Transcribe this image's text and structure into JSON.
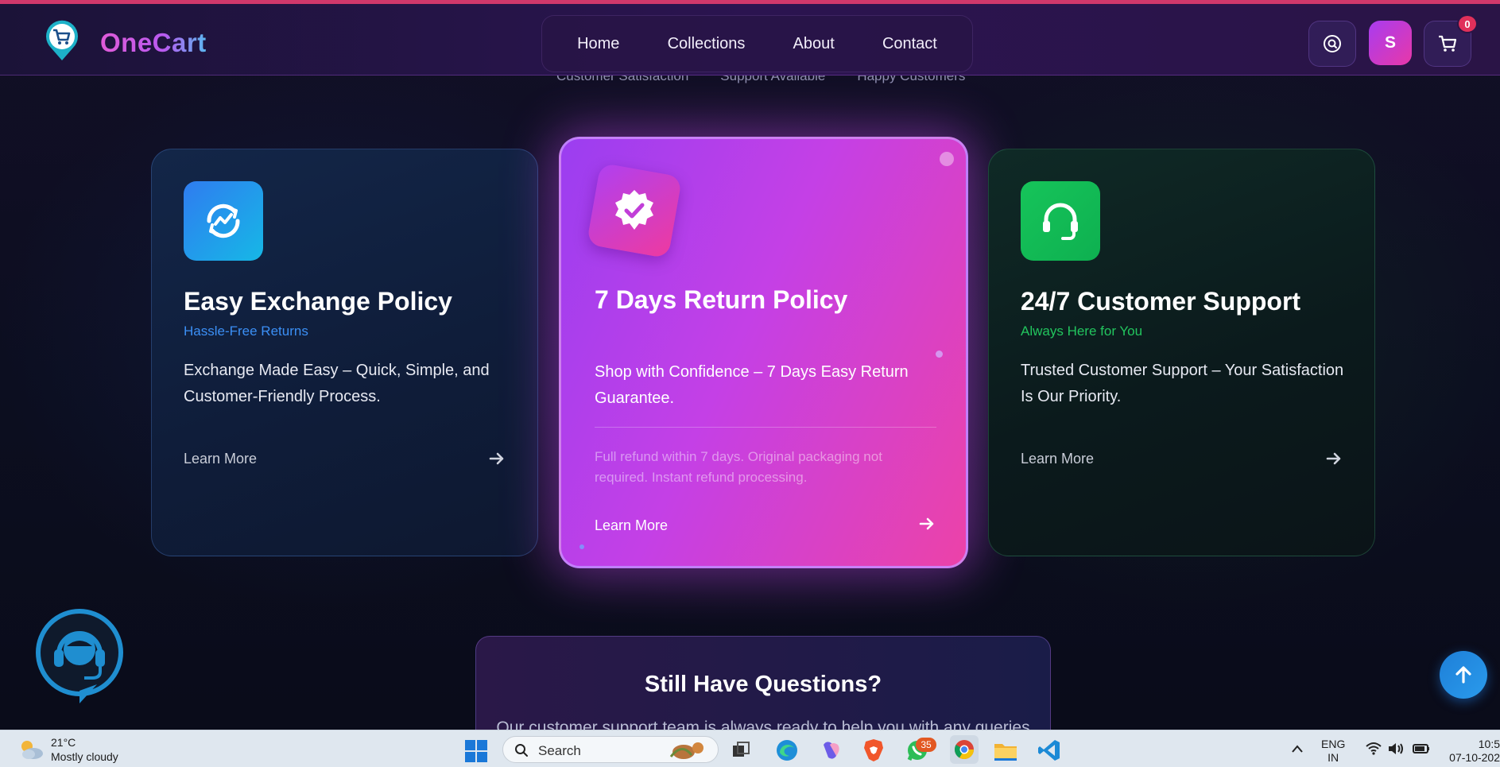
{
  "brand": {
    "name": "OneCart"
  },
  "nav": {
    "links": [
      "Home",
      "Collections",
      "About",
      "Contact"
    ],
    "cart_count": "0",
    "avatar_initial": "S"
  },
  "stats_labels": [
    "Customer Satisfaction",
    "Support Available",
    "Happy Customers"
  ],
  "cards": [
    {
      "title": "Easy Exchange Policy",
      "subtitle": "Hassle-Free Returns",
      "description": "Exchange Made Easy – Quick, Simple, and Customer-Friendly Process.",
      "link": "Learn More",
      "accent": "#2f8ef0",
      "icon": "exchange-refresh-icon"
    },
    {
      "title": "7 Days Return Policy",
      "description": "Shop with Confidence – 7 Days Easy Return Guarantee.",
      "details": "Full refund within 7 days. Original packaging not required. Instant refund processing.",
      "link": "Learn More",
      "accent": "#c440e6",
      "icon": "verified-badge-icon"
    },
    {
      "title": "24/7 Customer Support",
      "subtitle": "Always Here for You",
      "description": "Trusted Customer Support – Your Satisfaction Is Our Priority.",
      "link": "Learn More",
      "accent": "#22c55e",
      "icon": "headset-icon"
    }
  ],
  "questions": {
    "title": "Still Have Questions?",
    "text": "Our customer support team is always ready to help you with any queries"
  },
  "taskbar": {
    "weather_temp": "21°C",
    "weather_desc": "Mostly cloudy",
    "search_label": "Search",
    "whatsapp_badge": "35",
    "lang_line1": "ENG",
    "lang_line2": "IN",
    "time": "10:5",
    "date": "07-10-202"
  }
}
